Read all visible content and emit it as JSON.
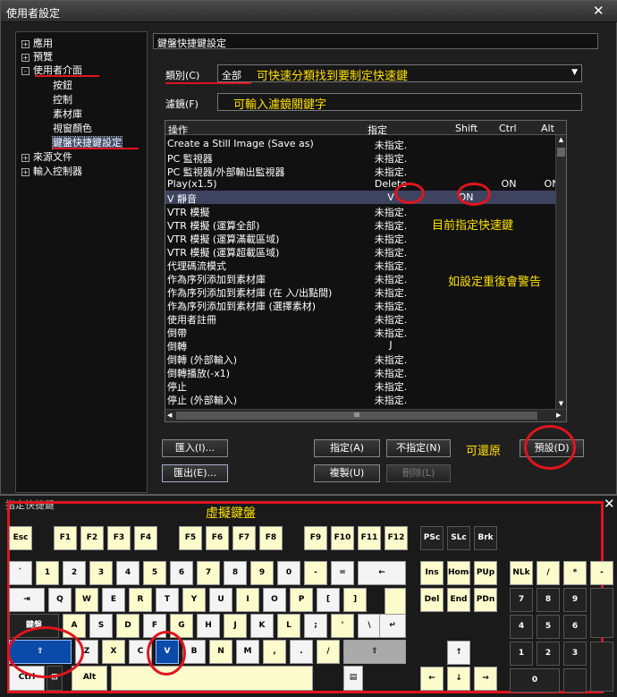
{
  "window": {
    "title": "使用者設定"
  },
  "tree": {
    "items": [
      {
        "label": "應用",
        "expander": "+"
      },
      {
        "label": "預覽",
        "expander": "+"
      },
      {
        "label": "使用者介面",
        "expander": "-"
      },
      {
        "label": "按鈕"
      },
      {
        "label": "控制"
      },
      {
        "label": "素材庫"
      },
      {
        "label": "視窗顏色"
      },
      {
        "label": "鍵盤快捷鍵設定"
      },
      {
        "label": "來源文件",
        "expander": "+"
      },
      {
        "label": "輸入控制器",
        "expander": "+"
      }
    ]
  },
  "panel": {
    "title": "鍵盤快捷鍵設定"
  },
  "category": {
    "label": "類別(C)",
    "value": "全部"
  },
  "filter": {
    "label": "濾鏡(F)",
    "value": ""
  },
  "annotations": {
    "category_hint": "可快速分類找到要制定快速鍵",
    "filter_hint": "可輸入濾鏡關鍵字",
    "current_key": "目前指定快速鍵",
    "duplicate_warning": "如設定重復會警告",
    "restore": "可還原",
    "virtual_keyboard": "虛擬鍵盤"
  },
  "grid": {
    "headers": {
      "operation": "操作",
      "assign": "指定",
      "shift": "Shift",
      "ctrl": "Ctrl",
      "alt": "Alt"
    },
    "rows": [
      {
        "op": "Create a Still Image (Save as)",
        "key": "未指定.",
        "shift": "",
        "ctrl": "",
        "alt": ""
      },
      {
        "op": "PC 監視器",
        "key": "未指定.",
        "shift": "",
        "ctrl": "",
        "alt": ""
      },
      {
        "op": "PC 監視器/外部輸出監視器",
        "key": "未指定.",
        "shift": "",
        "ctrl": "",
        "alt": ""
      },
      {
        "op": "Play(x1.5)",
        "key": "Delete",
        "shift": "",
        "ctrl": "ON",
        "alt": "ON"
      },
      {
        "op": "V 靜音",
        "key": "V",
        "shift": "ON",
        "ctrl": "",
        "alt": ""
      },
      {
        "op": "VTR 模擬",
        "key": "未指定.",
        "shift": "",
        "ctrl": "",
        "alt": ""
      },
      {
        "op": "VTR 模擬 (運算全部)",
        "key": "未指定.",
        "shift": "",
        "ctrl": "",
        "alt": ""
      },
      {
        "op": "VTR 模擬 (運算滿載區域)",
        "key": "未指定.",
        "shift": "",
        "ctrl": "",
        "alt": ""
      },
      {
        "op": "VTR 模擬 (運算超載區域)",
        "key": "未指定.",
        "shift": "",
        "ctrl": "",
        "alt": ""
      },
      {
        "op": "代理碼流模式",
        "key": "未指定.",
        "shift": "",
        "ctrl": "",
        "alt": ""
      },
      {
        "op": "作為序列添加到素材庫",
        "key": "未指定.",
        "shift": "",
        "ctrl": "",
        "alt": ""
      },
      {
        "op": "作為序列添加到素材庫 (在 入/出點間)",
        "key": "未指定.",
        "shift": "",
        "ctrl": "",
        "alt": ""
      },
      {
        "op": "作為序列添加到素材庫 (選擇素材)",
        "key": "未指定.",
        "shift": "",
        "ctrl": "",
        "alt": ""
      },
      {
        "op": "使用者註冊",
        "key": "未指定.",
        "shift": "",
        "ctrl": "",
        "alt": ""
      },
      {
        "op": "倒帶",
        "key": "未指定.",
        "shift": "",
        "ctrl": "",
        "alt": ""
      },
      {
        "op": "倒轉",
        "key": "J",
        "shift": "",
        "ctrl": "",
        "alt": ""
      },
      {
        "op": "倒轉 (外部輸入)",
        "key": "未指定.",
        "shift": "",
        "ctrl": "",
        "alt": ""
      },
      {
        "op": "倒轉播放(-x1)",
        "key": "未指定.",
        "shift": "",
        "ctrl": "",
        "alt": ""
      },
      {
        "op": "停止",
        "key": "未指定.",
        "shift": "",
        "ctrl": "",
        "alt": ""
      },
      {
        "op": "停止 (外部輸入)",
        "key": "未指定.",
        "shift": "",
        "ctrl": "",
        "alt": ""
      }
    ],
    "hscroll_grip": "III"
  },
  "buttons": {
    "import": "匯入(I)...",
    "export": "匯出(E)...",
    "assign": "指定(A)",
    "unassign": "不指定(N)",
    "copy": "複製(U)",
    "delete": "刪除(L)",
    "default": "預設(D)"
  },
  "keyboard": {
    "title": "指定快捷鍵",
    "function_row": [
      "Esc",
      "F1",
      "F2",
      "F3",
      "F4",
      "F5",
      "F6",
      "F7",
      "F8",
      "F9",
      "F10",
      "F11",
      "F12",
      "PSc",
      "SLc",
      "Brk"
    ],
    "number_row": [
      "`",
      "1",
      "2",
      "3",
      "4",
      "5",
      "6",
      "7",
      "8",
      "9",
      "0",
      "-",
      "=",
      "←"
    ],
    "qwerty_row": [
      "⇥",
      "Q",
      "W",
      "E",
      "R",
      "T",
      "Y",
      "U",
      "I",
      "O",
      "P",
      "[",
      "]",
      ""
    ],
    "home_row": [
      "鍵盤",
      "A",
      "S",
      "D",
      "F",
      "G",
      "H",
      "J",
      "K",
      "L",
      ";",
      "'",
      "\\",
      "↵"
    ],
    "shift_row": [
      "⇧",
      "Z",
      "X",
      "C",
      "V",
      "B",
      "N",
      "M",
      ",",
      ".",
      "/",
      "⇧"
    ],
    "bottom_row": [
      "Ctrl",
      "⊞",
      "Alt",
      "",
      "▤"
    ],
    "nav_top": [
      "Ins",
      "Home",
      "PUp"
    ],
    "nav_bottom": [
      "Del",
      "End",
      "PDn"
    ],
    "arrows": [
      "↑",
      "←",
      "↓",
      "→"
    ],
    "numpad": [
      [
        "NLk",
        "/",
        "*",
        "-"
      ],
      [
        "7",
        "8",
        "9",
        ""
      ],
      [
        "4",
        "5",
        "6",
        ""
      ],
      [
        "1",
        "2",
        "3",
        ""
      ],
      [
        "0",
        "",
        "",
        ""
      ]
    ]
  }
}
